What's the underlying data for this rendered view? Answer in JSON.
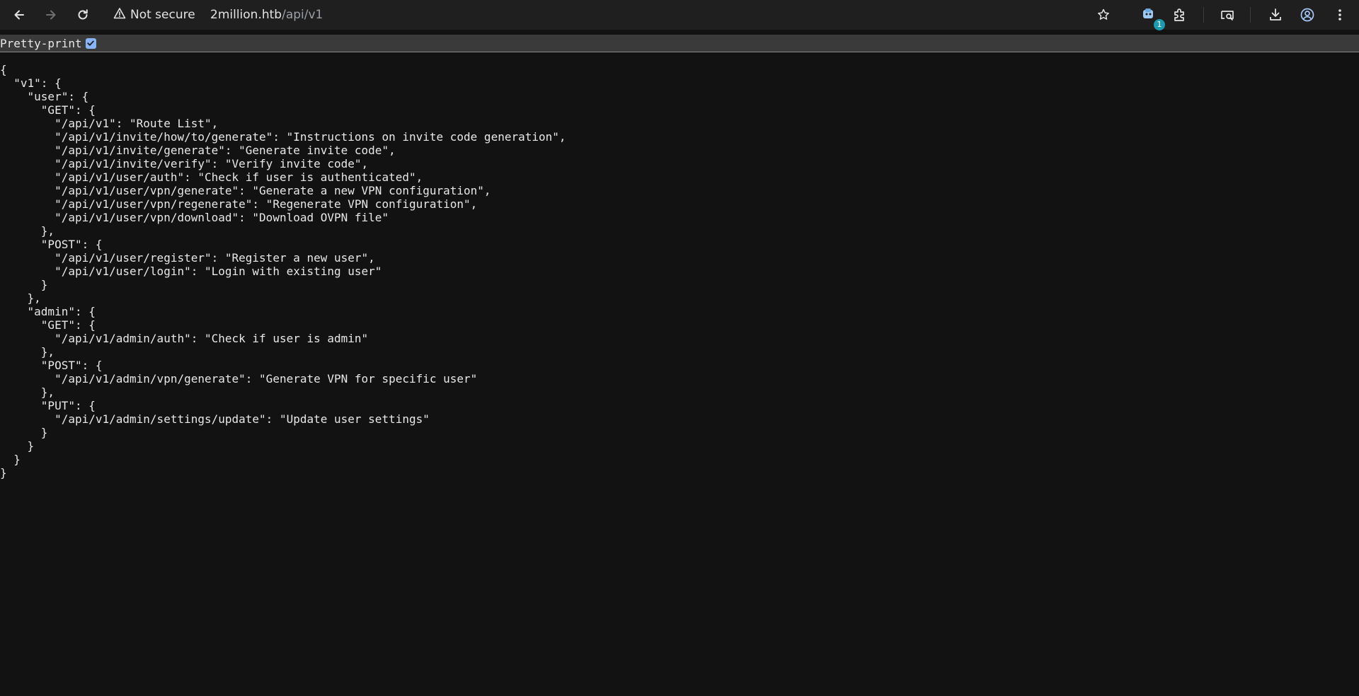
{
  "browser": {
    "security_label": "Not secure",
    "url_host": "2million.htb",
    "url_path": "/api/v1",
    "extensions_badge": "1"
  },
  "icons": {
    "back": "arrow-left-icon",
    "forward": "arrow-right-icon",
    "reload": "reload-icon",
    "warning": "warning-triangle-icon",
    "bookmark": "star-icon",
    "extension_app": "extension-app-icon",
    "extensions": "puzzle-icon",
    "search_tab": "tab-search-icon",
    "download": "download-icon",
    "profile": "profile-icon",
    "menu": "kebab-menu-icon"
  },
  "pretty_print": {
    "label": "Pretty-print",
    "checked": true
  },
  "json_lines": [
    "{",
    "  \"v1\": {",
    "    \"user\": {",
    "      \"GET\": {",
    "        \"/api/v1\": \"Route List\",",
    "        \"/api/v1/invite/how/to/generate\": \"Instructions on invite code generation\",",
    "        \"/api/v1/invite/generate\": \"Generate invite code\",",
    "        \"/api/v1/invite/verify\": \"Verify invite code\",",
    "        \"/api/v1/user/auth\": \"Check if user is authenticated\",",
    "        \"/api/v1/user/vpn/generate\": \"Generate a new VPN configuration\",",
    "        \"/api/v1/user/vpn/regenerate\": \"Regenerate VPN configuration\",",
    "        \"/api/v1/user/vpn/download\": \"Download OVPN file\"",
    "      },",
    "      \"POST\": {",
    "        \"/api/v1/user/register\": \"Register a new user\",",
    "        \"/api/v1/user/login\": \"Login with existing user\"",
    "      }",
    "    },",
    "    \"admin\": {",
    "      \"GET\": {",
    "        \"/api/v1/admin/auth\": \"Check if user is admin\"",
    "      },",
    "      \"POST\": {",
    "        \"/api/v1/admin/vpn/generate\": \"Generate VPN for specific user\"",
    "      },",
    "      \"PUT\": {",
    "        \"/api/v1/admin/settings/update\": \"Update user settings\"",
    "      }",
    "    }",
    "  }",
    "}"
  ]
}
